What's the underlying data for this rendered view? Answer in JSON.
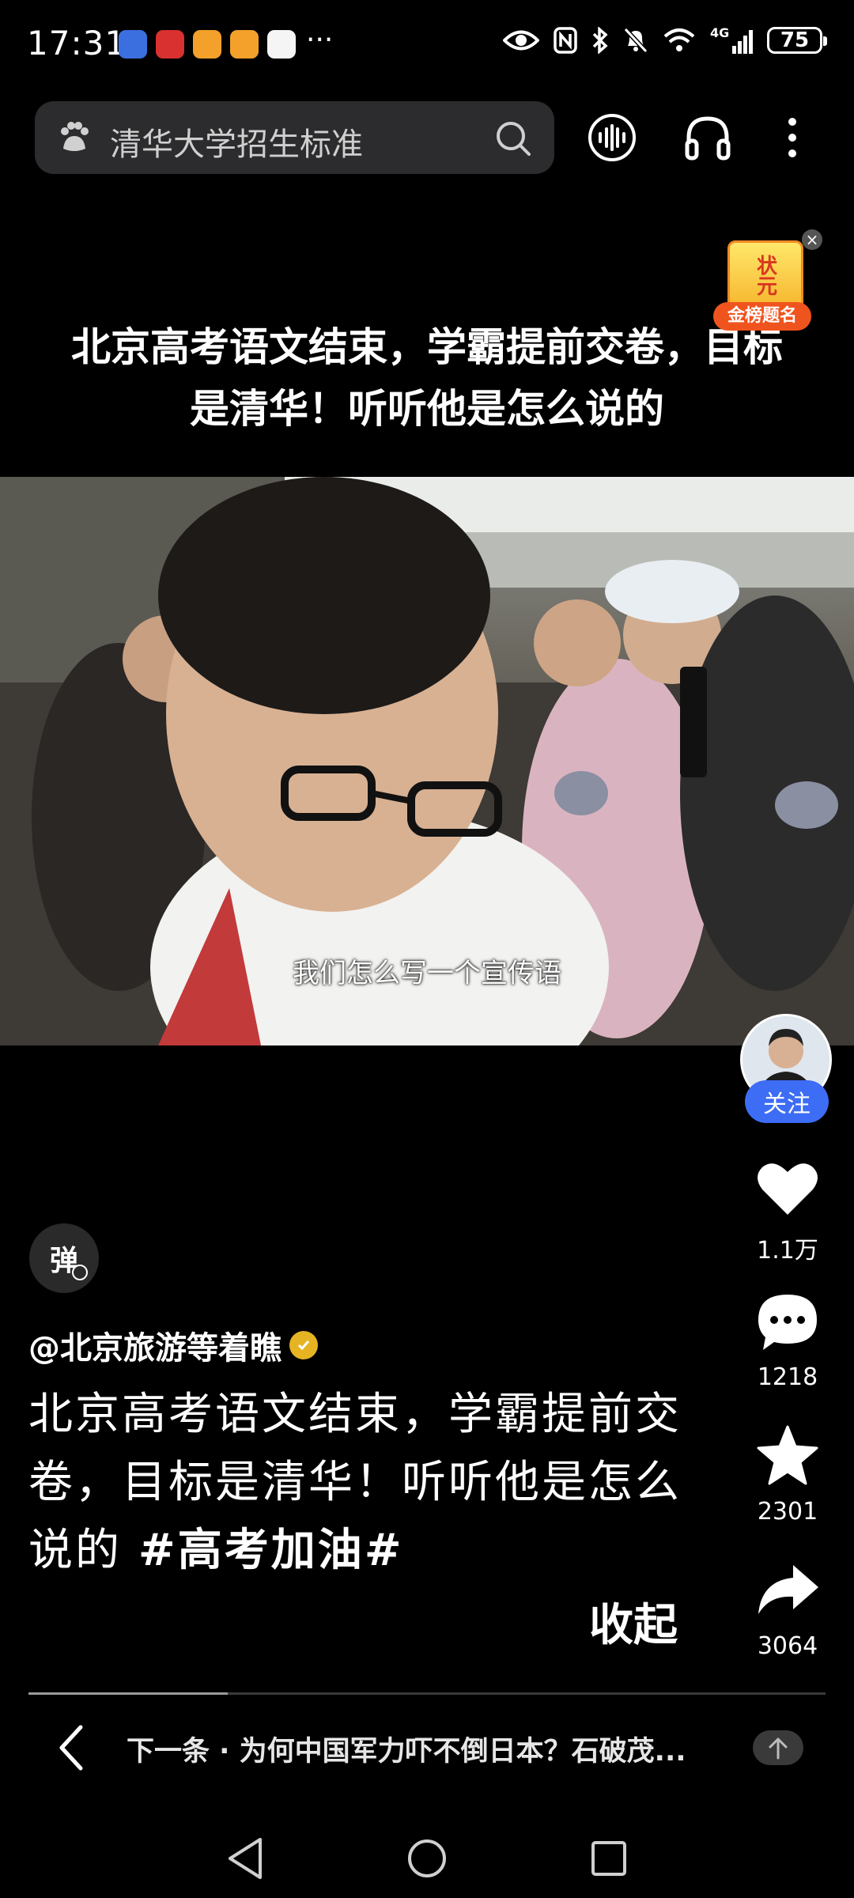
{
  "status_bar": {
    "time": "17:31",
    "more": "···",
    "network": "4G",
    "battery": "75"
  },
  "search": {
    "query": "清华大学招生标准"
  },
  "video": {
    "heading_line1": "北京高考语文结束，学霸提前交卷，目标",
    "heading_line2": "是清华！听听他是怎么说的",
    "subtitle": "我们怎么写一个宣传语",
    "progress": 0.25
  },
  "promo_badge": {
    "top_text": "状元",
    "bottom_text": "金榜题名"
  },
  "actions": {
    "follow_label": "关注",
    "like_count": "1.1万",
    "comment_count": "1218",
    "favorite_count": "2301",
    "share_count": "3064"
  },
  "danmaku_label": "弹",
  "post": {
    "author": "@北京旅游等着瞧",
    "caption": "北京高考语文结束，学霸提前交卷，目标是清华！听听他是怎么说的",
    "hashtag": "#高考加油#",
    "collapse_label": "收起"
  },
  "next": {
    "text": "下一条 · 为何中国军力吓不倒日本？石破茂..."
  },
  "colors": {
    "background": "#000000",
    "accent_blue": "#3d6cf5",
    "search_bg": "#2c2c2e"
  }
}
